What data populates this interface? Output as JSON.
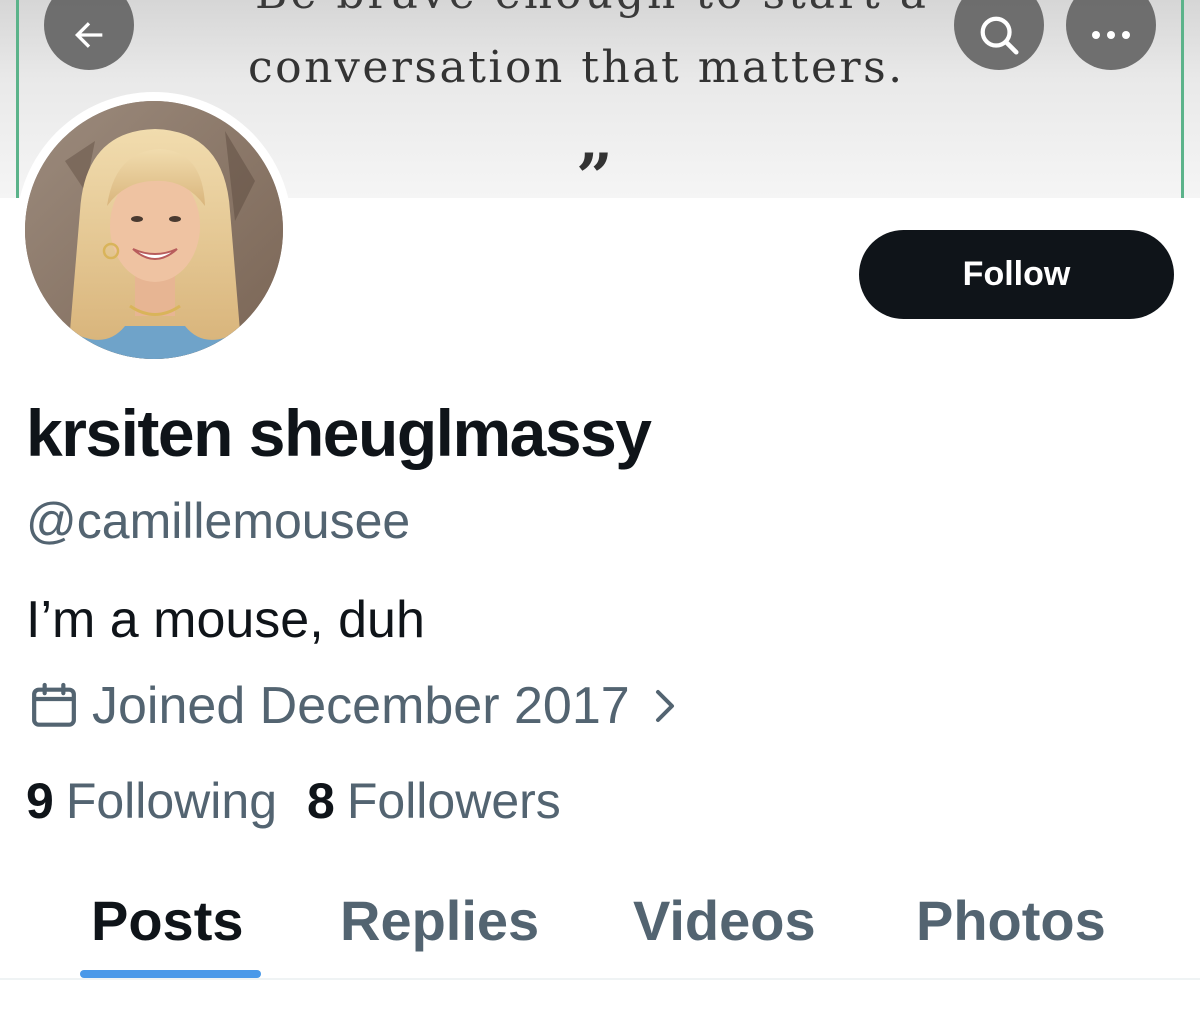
{
  "banner": {
    "quote_line1": "Be brave enough to start a",
    "quote_line2": "conversation that matters.",
    "quote_mark": "”"
  },
  "header": {
    "back_icon": "arrow-left-icon",
    "search_icon": "search-icon",
    "more_icon": "more-horizontal-icon"
  },
  "profile": {
    "follow_label": "Follow",
    "display_name": "krsiten sheuglmassy",
    "handle": "@camillemousee",
    "bio": "I’m a mouse, duh",
    "joined": "Joined December 2017",
    "following_count": "9",
    "following_label": "Following",
    "followers_count": "8",
    "followers_label": "Followers"
  },
  "tabs": [
    {
      "label": "Posts",
      "active": true
    },
    {
      "label": "Replies",
      "active": false
    },
    {
      "label": "Videos",
      "active": false
    },
    {
      "label": "Photos",
      "active": false
    }
  ],
  "colors": {
    "follow_bg": "#0f1419",
    "secondary_text": "#536471",
    "tab_indicator": "#4a99e9",
    "banner_accent": "#5bb38a"
  }
}
